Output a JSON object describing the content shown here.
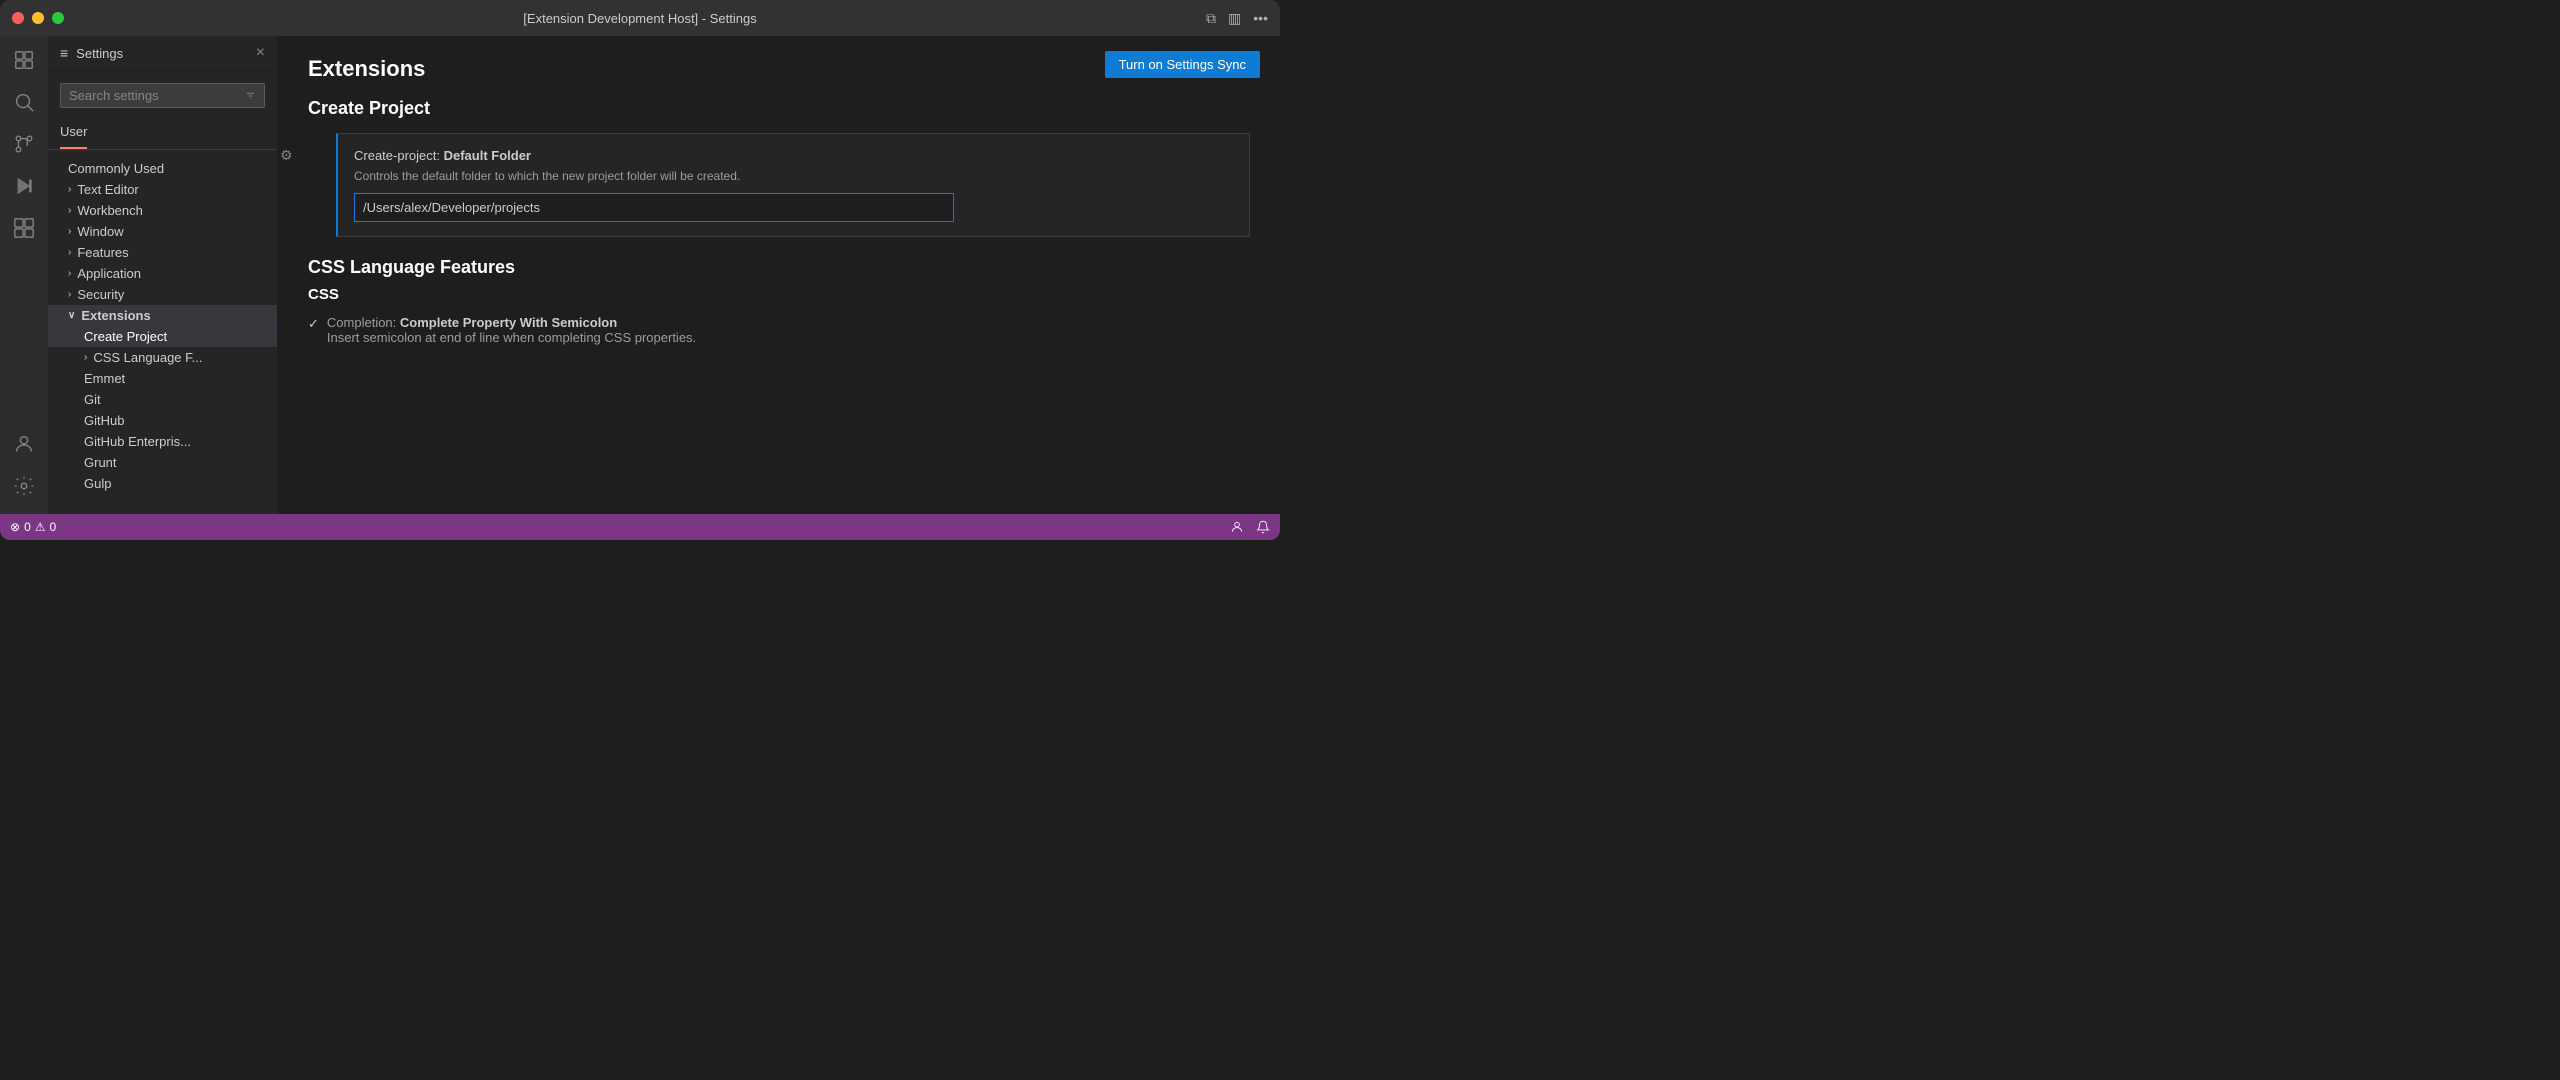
{
  "titlebar": {
    "title": "[Extension Development Host] - Settings",
    "buttons": {
      "close": "close",
      "minimize": "minimize",
      "maximize": "maximize"
    }
  },
  "sidebar": {
    "header": {
      "icon": "≡",
      "title": "Settings",
      "close": "×"
    },
    "search_placeholder": "Search settings",
    "tabs": [
      {
        "label": "User",
        "active": true
      }
    ],
    "nav": [
      {
        "label": "Commonly Used",
        "type": "item",
        "indent": 0
      },
      {
        "label": "Text Editor",
        "type": "collapsed",
        "indent": 0
      },
      {
        "label": "Workbench",
        "type": "collapsed",
        "indent": 0
      },
      {
        "label": "Window",
        "type": "collapsed",
        "indent": 0
      },
      {
        "label": "Features",
        "type": "collapsed",
        "indent": 0
      },
      {
        "label": "Application",
        "type": "collapsed",
        "indent": 0
      },
      {
        "label": "Security",
        "type": "collapsed",
        "indent": 0
      },
      {
        "label": "Extensions",
        "type": "expanded",
        "indent": 0
      },
      {
        "label": "Create Project",
        "type": "sub-item",
        "indent": 1
      },
      {
        "label": "CSS Language F...",
        "type": "sub-collapsed",
        "indent": 1
      },
      {
        "label": "Emmet",
        "type": "sub-item",
        "indent": 1
      },
      {
        "label": "Git",
        "type": "sub-item",
        "indent": 1
      },
      {
        "label": "GitHub",
        "type": "sub-item",
        "indent": 1
      },
      {
        "label": "GitHub Enterpris...",
        "type": "sub-item",
        "indent": 1
      },
      {
        "label": "Grunt",
        "type": "sub-item",
        "indent": 1
      },
      {
        "label": "Gulp",
        "type": "sub-item",
        "indent": 1
      }
    ]
  },
  "content": {
    "sync_button": "Turn on Settings Sync",
    "tab_user": "User",
    "section_title": "Extensions",
    "subsection_create_project": "Create Project",
    "setting_create_project": {
      "label_prefix": "Create-project: ",
      "label_bold": "Default Folder",
      "description": "Controls the default folder to which the new project folder will be created.",
      "value": "/Users/alex/Developer/projects"
    },
    "subsection_css": "CSS Language Features",
    "css_title": "CSS",
    "completion_setting": {
      "label_prefix": "Completion: ",
      "label_bold": "Complete Property With Semicolon",
      "check": "✓",
      "description": "Insert semicolon at end of line when completing CSS properties."
    }
  },
  "statusbar": {
    "error_icon": "⊗",
    "error_count": "0",
    "warning_icon": "⚠",
    "warning_count": "0",
    "right_icons": [
      "person-icon",
      "bell-icon"
    ]
  },
  "activity_bar": {
    "items": [
      {
        "icon": "⬜",
        "name": "explorer-icon"
      },
      {
        "icon": "🔍",
        "name": "search-icon"
      },
      {
        "icon": "⑂",
        "name": "source-control-icon"
      },
      {
        "icon": "▷",
        "name": "run-debug-icon"
      },
      {
        "icon": "⊞",
        "name": "extensions-icon"
      }
    ],
    "bottom": [
      {
        "icon": "👤",
        "name": "account-icon"
      },
      {
        "icon": "⚙",
        "name": "settings-icon"
      }
    ]
  }
}
